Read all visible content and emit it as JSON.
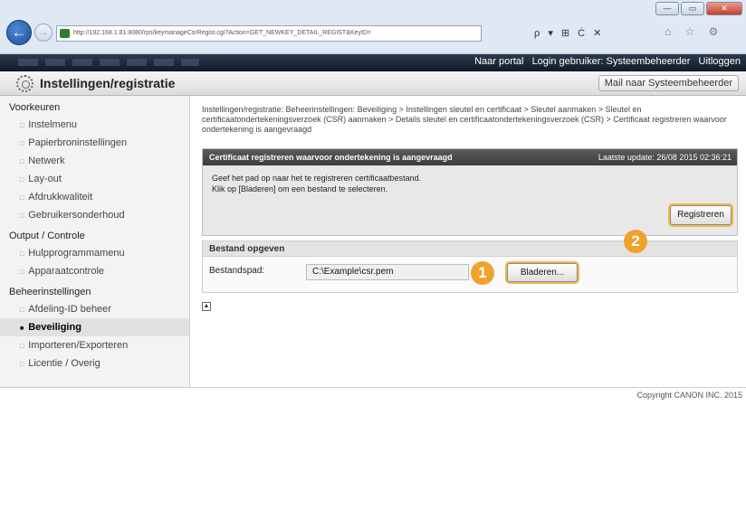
{
  "browser": {
    "url": "http://192.168.1.81:8080/rps/keymanageCsrRegist.cgi?Action=GET_NEWKEY_DETAIL_REGIST&KeyID=",
    "search_label": "ρ",
    "addr_tools": "▾ ⊞ Ċ ✕",
    "nav_icons": "⌂ ☆ ⚙",
    "min_label": "—",
    "max_label": "▭",
    "close_label": "✕"
  },
  "topbar": {
    "portal": "Naar portal",
    "login": "Login gebruiker: Systeembeheerder",
    "logout": "Uitloggen"
  },
  "header": {
    "title": "Instellingen/registratie",
    "mail_button": "Mail naar Systeembeheerder"
  },
  "sidebar": {
    "groups": [
      {
        "label": "Voorkeuren",
        "items": [
          "Instelmenu",
          "Papierbroninstellingen",
          "Netwerk",
          "Lay-out",
          "Afdrukkwaliteit",
          "Gebruikersonderhoud"
        ]
      },
      {
        "label": "Output / Controle",
        "items": [
          "Hulpprogrammamenu",
          "Apparaatcontrole"
        ]
      },
      {
        "label": "Beheerinstellingen",
        "items": [
          "Afdeling-ID beheer",
          "Beveiliging",
          "Importeren/Exporteren",
          "Licentie / Overig"
        ]
      }
    ]
  },
  "breadcrumb": "Instellingen/registratie: Beheerinstellingen: Beveiliging > Instellingen sleutel en certificaat > Sleutel aanmaken > Sleutel en certificaatondertekeningsverzoek (CSR) aanmaken > Details sleutel en certificaatondertekeningsverzoek (CSR) > Certificaat registreren waarvoor ondertekening is aangevraagd",
  "panel": {
    "title": "Certificaat registreren waarvoor ondertekening is aangevraagd",
    "last_update": "Laatste update: 26/08 2015 02:36:21",
    "instruction_1": "Geef het pad op naar het te registreren certificaatbestand.",
    "instruction_2": "Klik op [Bladeren] om een bestand te selecteren.",
    "register_button": "Registreren"
  },
  "file": {
    "section_title": "Bestand opgeven",
    "path_label": "Bestandspad:",
    "path_value": "C:\\Example\\csr.pem",
    "browse_button": "Bladeren..."
  },
  "callouts": {
    "first": "1",
    "second": "2"
  },
  "footer": {
    "copyright": "Copyright CANON INC. 2015"
  }
}
